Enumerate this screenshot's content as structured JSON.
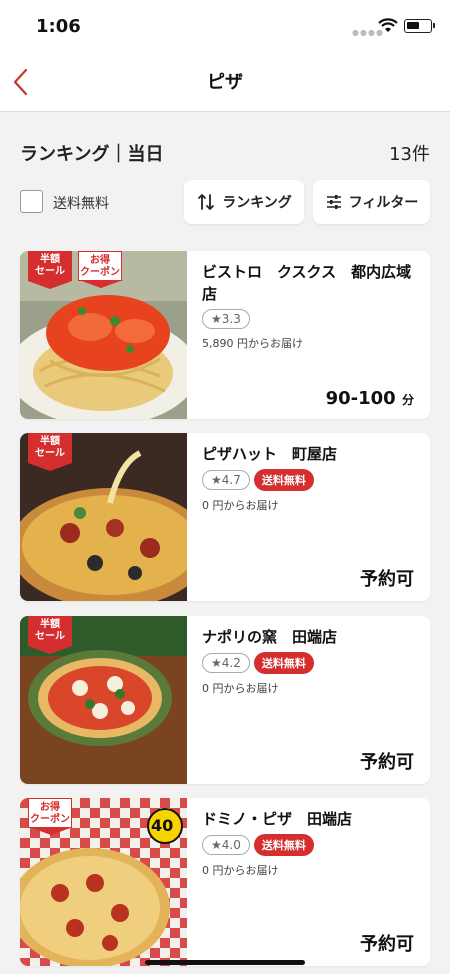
{
  "status_bar": {
    "time": "1:06"
  },
  "nav": {
    "title": "ピザ"
  },
  "ranking": {
    "title": "ランキング｜当日",
    "count": "13件"
  },
  "filters": {
    "free_shipping_label": "送料無料",
    "sort_label": "ランキング",
    "filter_label": "フィルター"
  },
  "restaurants": [
    {
      "name": "ビストロ　クスクス　都内広域店",
      "rating": "★3.3",
      "min_order": "5,890 円からお届け",
      "eta": "90-100",
      "eta_unit": "分",
      "badge_half": "半額セール",
      "badge_deal": "お得クーポン"
    },
    {
      "name": "ピザハット　町屋店",
      "rating": "★4.7",
      "free_shipping": "送料無料",
      "min_order": "0 円からお届け",
      "eta": "予約可",
      "badge_half": "半額セール"
    },
    {
      "name": "ナポリの窯　田端店",
      "rating": "★4.2",
      "free_shipping": "送料無料",
      "min_order": "0 円からお届け",
      "eta": "予約可",
      "badge_half": "半額セール"
    },
    {
      "name": "ドミノ・ピザ　田端店",
      "rating": "★4.0",
      "free_shipping": "送料無料",
      "min_order": "0 円からお届け",
      "eta": "予約可",
      "badge_deal": "お得クーポン",
      "promo_number": "40"
    }
  ],
  "colors": {
    "accent": "#d42e2e",
    "background": "#f2f2f2"
  }
}
